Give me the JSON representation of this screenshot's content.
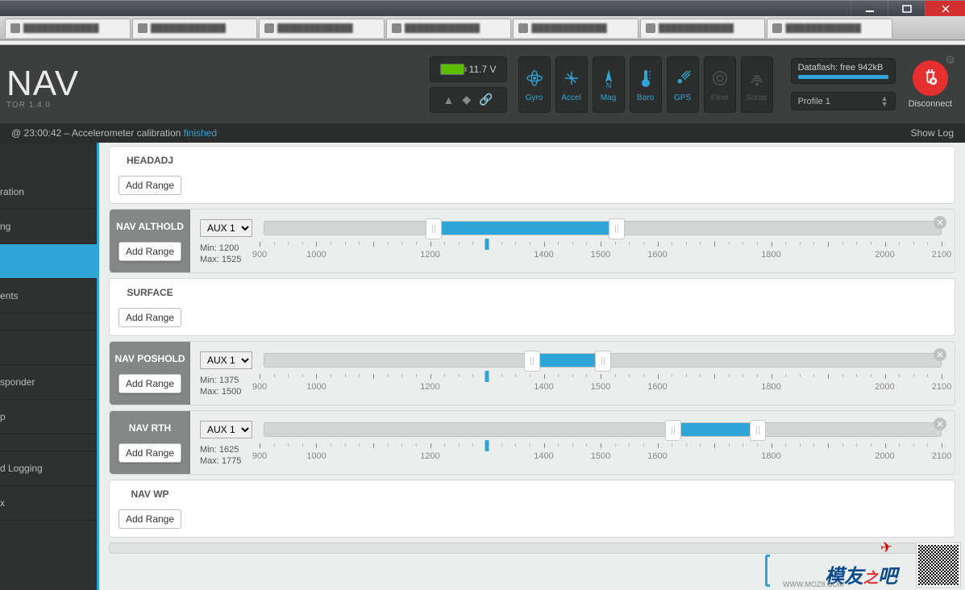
{
  "window": {
    "min": "min",
    "max": "max",
    "close": "close"
  },
  "header": {
    "title": "NAV",
    "subtitle": "TOR  1.4.0",
    "battery_voltage": "11.7 V",
    "sensors": [
      {
        "name": "Gyro",
        "on": true
      },
      {
        "name": "Accel",
        "on": true
      },
      {
        "name": "Mag",
        "on": true
      },
      {
        "name": "Baro",
        "on": true
      },
      {
        "name": "GPS",
        "on": true
      },
      {
        "name": "Flow",
        "on": false
      },
      {
        "name": "Sonar",
        "on": false
      }
    ],
    "dataflash": "Dataflash: free 942kB",
    "profile": "Profile 1",
    "disconnect": "Disconnect"
  },
  "status": {
    "timestamp": "23:00:42",
    "message": "Accelerometer calibration",
    "result": "finished",
    "show_log": "Show Log"
  },
  "sidebar": {
    "items": [
      "ration",
      "ng",
      "",
      "ents",
      "",
      "sponder",
      "p",
      "d Logging",
      "x"
    ]
  },
  "modes": {
    "add_range_label": "Add Range",
    "aux_label": "AUX 1",
    "scale_min": 900,
    "scale_max": 2100,
    "scale_labels": [
      900,
      1000,
      1200,
      1400,
      1500,
      1600,
      1800,
      2000,
      2100
    ],
    "marker": 1300,
    "list": [
      {
        "name": "HEADADJ",
        "has_range": false
      },
      {
        "name": "NAV ALTHOLD",
        "has_range": true,
        "min": 1200,
        "max": 1525
      },
      {
        "name": "SURFACE",
        "has_range": false
      },
      {
        "name": "NAV POSHOLD",
        "has_range": true,
        "min": 1375,
        "max": 1500
      },
      {
        "name": "NAV RTH",
        "has_range": true,
        "min": 1625,
        "max": 1775
      },
      {
        "name": "NAV WP",
        "has_range": false
      }
    ]
  },
  "watermark": {
    "text1": "模友",
    "text2": "之",
    "text3": "吧",
    "sub": "WWW.MOZ8.COM"
  }
}
